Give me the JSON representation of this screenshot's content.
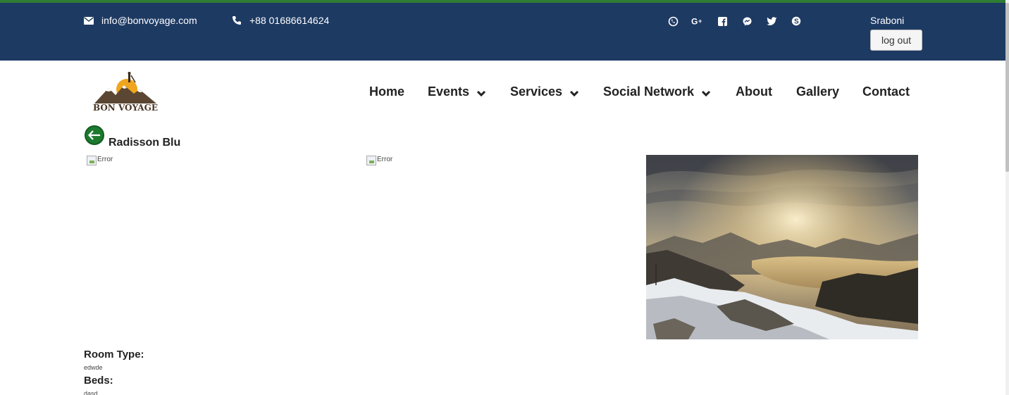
{
  "header": {
    "email": "info@bonvoyage.com",
    "phone": "+88 01686614624",
    "socials": [
      "viber-icon",
      "google-plus-icon",
      "facebook-icon",
      "messenger-icon",
      "twitter-icon",
      "skype-icon"
    ],
    "user_name": "Sraboni",
    "logout_label": "log out",
    "bg_color": "#1d3a63",
    "accent_color": "#2e7d32"
  },
  "logo": {
    "text": "BON VOYAGE"
  },
  "nav": {
    "home": "Home",
    "events": "Events",
    "services": "Services",
    "social_network": "Social Network",
    "about": "About",
    "gallery": "Gallery",
    "contact": "Contact"
  },
  "hotel": {
    "name": "Radisson Blu",
    "image_alt_1": "Error",
    "image_alt_2": "Error"
  },
  "details": {
    "room_type_label": "Room Type:",
    "room_type_value": "edwde",
    "beds_label": "Beds:",
    "beds_value": "dasd"
  }
}
